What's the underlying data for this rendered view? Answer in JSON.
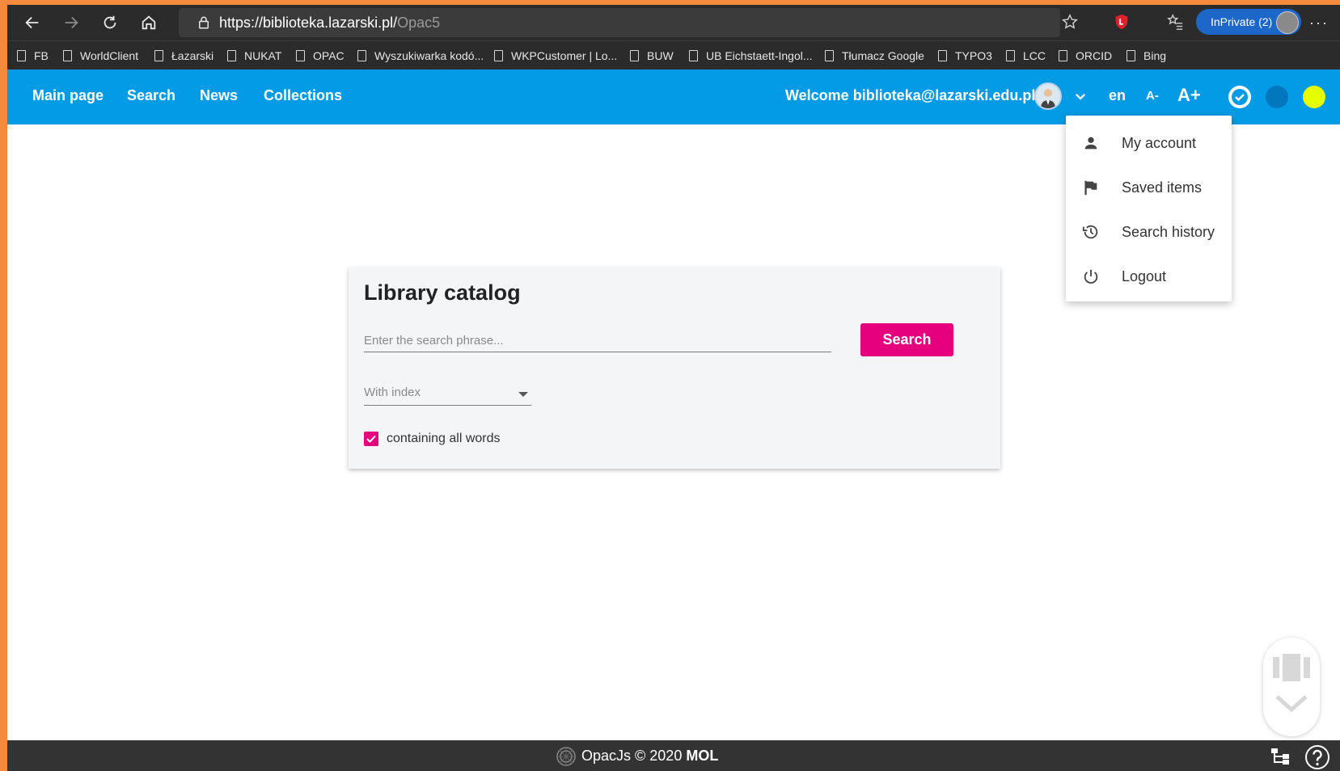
{
  "browser": {
    "url_host": "https://biblioteka.lazarski.pl/",
    "url_path": "Opac5",
    "inprivate_label": "InPrivate (2)",
    "more_label": "···",
    "bookmarks": [
      "FB",
      "WorldClient",
      "Łazarski",
      "NUKAT",
      "OPAC",
      "Wyszukiwarka kodó...",
      "WKPCustomer | Lo...",
      "BUW",
      "UB Eichstaett-Ingol...",
      "Tłumacz Google",
      "TYPO3",
      "LCC",
      "ORCID",
      "Bing"
    ]
  },
  "header": {
    "nav": [
      "Main page",
      "Search",
      "News",
      "Collections"
    ],
    "welcome": "Welcome biblioteka@lazarski.edu.pl",
    "lang": "en",
    "font_smaller": "A-",
    "font_larger": "A+",
    "background_color": "#039be5",
    "contrast_colors": [
      "#ffffff",
      "#0277bd",
      "#e6ff00"
    ]
  },
  "user_menu": {
    "items": [
      {
        "label": "My account",
        "icon": "person-icon"
      },
      {
        "label": "Saved items",
        "icon": "flag-icon"
      },
      {
        "label": "Search history",
        "icon": "history-icon"
      },
      {
        "label": "Logout",
        "icon": "power-icon"
      }
    ]
  },
  "catalog": {
    "title": "Library catalog",
    "search_placeholder": "Enter the search phrase...",
    "search_value": "",
    "search_button": "Search",
    "index_select": "With index",
    "checkbox_label": "containing all words",
    "checkbox_checked": true,
    "accent_color": "#e6007e"
  },
  "footer": {
    "text_main": "OpacJs © 2020 ",
    "text_brand": "MOL"
  }
}
